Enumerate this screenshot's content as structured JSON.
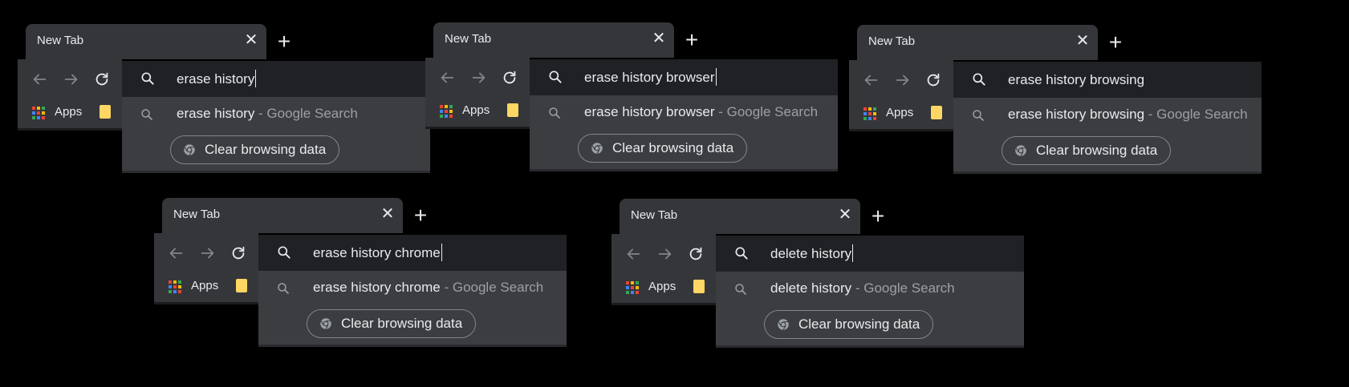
{
  "panels": [
    {
      "tab_title": "New Tab",
      "bookmark_apps_label": "Apps",
      "omnibox_text": "erase history",
      "caret_visible": true,
      "suggestion_query": "erase history",
      "suggestion_source": " - Google Search",
      "chip_label": "Clear browsing data"
    },
    {
      "tab_title": "New Tab",
      "bookmark_apps_label": "Apps",
      "omnibox_text": "erase history browser",
      "caret_visible": true,
      "suggestion_query": "erase history browser",
      "suggestion_source": " - Google Search",
      "chip_label": "Clear browsing data"
    },
    {
      "tab_title": "New Tab",
      "bookmark_apps_label": "Apps",
      "omnibox_text": "erase history browsing",
      "caret_visible": false,
      "suggestion_query": "erase history browsing",
      "suggestion_source": " - Google Search",
      "chip_label": "Clear browsing data"
    },
    {
      "tab_title": "New Tab",
      "bookmark_apps_label": "Apps",
      "omnibox_text": "erase history chrome",
      "caret_visible": true,
      "suggestion_query": "erase history chrome",
      "suggestion_source": " - Google Search",
      "chip_label": "Clear browsing data"
    },
    {
      "tab_title": "New Tab",
      "bookmark_apps_label": "Apps",
      "omnibox_text": "delete history",
      "caret_visible": true,
      "suggestion_query": "delete history",
      "suggestion_source": " - Google Search",
      "chip_label": "Clear browsing data"
    }
  ],
  "icons": {
    "tab_close": "close-icon",
    "new_tab": "plus-icon",
    "back": "arrow-back-icon",
    "forward": "arrow-forward-icon",
    "reload": "reload-icon",
    "apps": "apps-grid-icon",
    "bookmark_folder": "folder-icon",
    "search": "search-icon",
    "chip": "chrome-icon"
  },
  "colors": {
    "background": "#000000",
    "tab": "#35363a",
    "omnibox": "#202124",
    "dropdown": "#3c3d40",
    "text": "#e8eaed",
    "secondary_text": "#9aa0a6",
    "disabled_icon": "#80868b",
    "folder": "#fdd663",
    "apps_icon": [
      "#ea4335",
      "#fbbc04",
      "#34a853",
      "#4285f4",
      "#ea4335",
      "#fbbc04",
      "#34a853",
      "#4285f4",
      "#ea4335"
    ]
  }
}
